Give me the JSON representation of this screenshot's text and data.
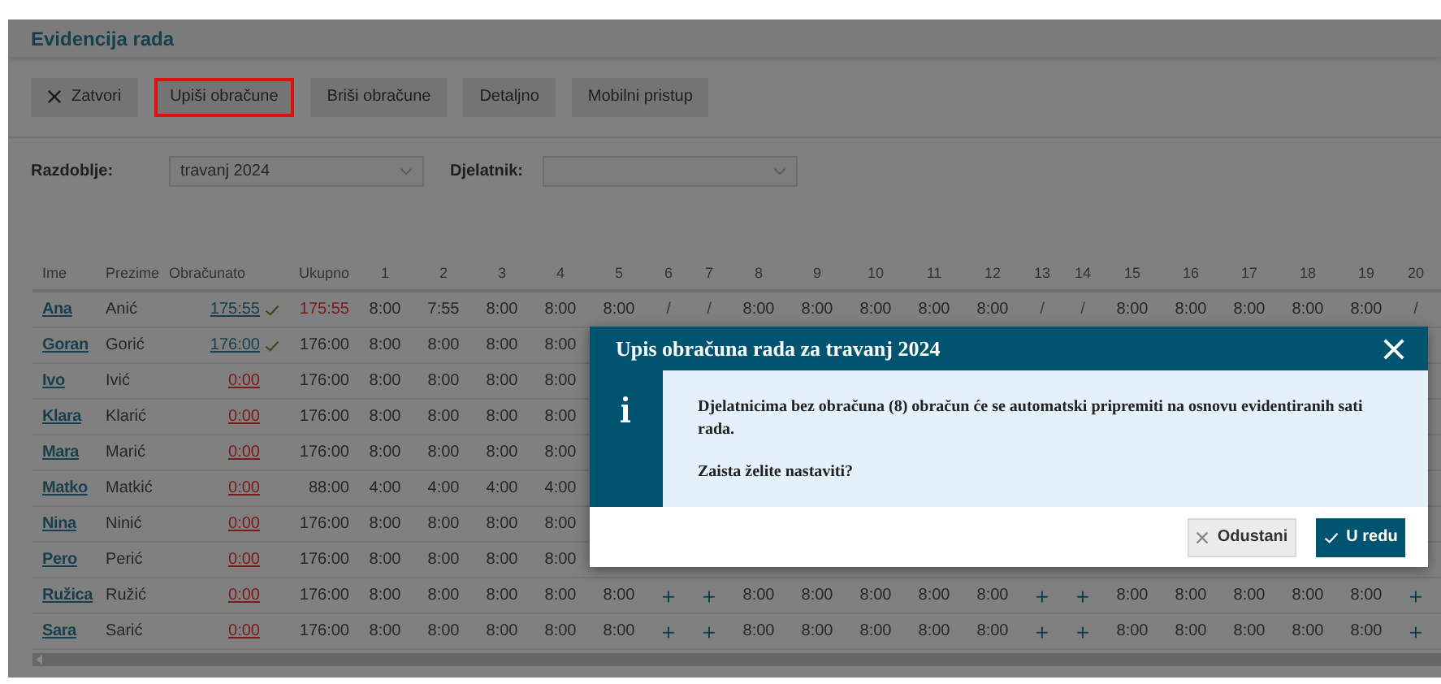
{
  "page": {
    "title": "Evidencija rada"
  },
  "toolbar": [
    {
      "label": "Zatvori",
      "kind": "close",
      "highlighted": false
    },
    {
      "label": "Upiši obračune",
      "kind": "plain",
      "highlighted": true
    },
    {
      "label": "Briši obračune",
      "kind": "plain",
      "highlighted": false
    },
    {
      "label": "Detaljno",
      "kind": "plain",
      "highlighted": false
    },
    {
      "label": "Mobilni pristup",
      "kind": "plain",
      "highlighted": false
    }
  ],
  "filters": [
    {
      "label": "Razdoblje:",
      "value": "travanj 2024"
    },
    {
      "label": "Djelatnik:"
    }
  ],
  "table": {
    "columns": [
      "Ime",
      "Prezime",
      "Obračunato",
      "Ukupno"
    ],
    "day_columns": [
      {
        "label": "1",
        "weekend": false
      },
      {
        "label": "2",
        "weekend": false
      },
      {
        "label": "3",
        "weekend": false
      },
      {
        "label": "4",
        "weekend": false
      },
      {
        "label": "5",
        "weekend": false
      },
      {
        "label": "6",
        "weekend": true
      },
      {
        "label": "7",
        "weekend": true
      },
      {
        "label": "8",
        "weekend": false
      },
      {
        "label": "9",
        "weekend": false
      },
      {
        "label": "10",
        "weekend": false
      },
      {
        "label": "11",
        "weekend": false
      },
      {
        "label": "12",
        "weekend": false
      },
      {
        "label": "13",
        "weekend": true
      },
      {
        "label": "14",
        "weekend": true
      },
      {
        "label": "15",
        "weekend": false
      },
      {
        "label": "16",
        "weekend": false
      },
      {
        "label": "17",
        "weekend": false
      },
      {
        "label": "18",
        "weekend": false
      },
      {
        "label": "19",
        "weekend": false
      },
      {
        "label": "20",
        "weekend": true
      }
    ],
    "rows": [
      {
        "ime": "Ana",
        "prezime": "Anić",
        "obracunato": "175:55",
        "obracunato_done": true,
        "ukupno": "175:55",
        "ukupno_warning": true,
        "days": [
          "8:00",
          "7:55",
          "8:00",
          "8:00",
          "8:00",
          {
            "text": "/",
            "kind": "off"
          },
          {
            "text": "/",
            "kind": "off"
          },
          "8:00",
          "8:00",
          "8:00",
          "8:00",
          "8:00",
          {
            "text": "/",
            "kind": "off"
          },
          {
            "text": "/",
            "kind": "off"
          },
          "8:00",
          "8:00",
          "8:00",
          "8:00",
          "8:00",
          {
            "text": "/",
            "kind": "off"
          }
        ]
      },
      {
        "ime": "Goran",
        "prezime": "Gorić",
        "obracunato": "176:00",
        "obracunato_done": true,
        "ukupno": "176:00",
        "ukupno_warning": false,
        "days": [
          "8:00",
          "8:00",
          "8:00",
          "8:00"
        ]
      },
      {
        "ime": "Ivo",
        "prezime": "Ivić",
        "obracunato": "0:00",
        "obracunato_done": false,
        "ukupno": "176:00",
        "ukupno_warning": false,
        "days": [
          "8:00",
          "8:00",
          "8:00",
          "8:00"
        ]
      },
      {
        "ime": "Klara",
        "prezime": "Klarić",
        "obracunato": "0:00",
        "obracunato_done": false,
        "ukupno": "176:00",
        "ukupno_warning": false,
        "days": [
          "8:00",
          "8:00",
          "8:00",
          "8:00"
        ]
      },
      {
        "ime": "Mara",
        "prezime": "Marić",
        "obracunato": "0:00",
        "obracunato_done": false,
        "ukupno": "176:00",
        "ukupno_warning": false,
        "days": [
          "8:00",
          "8:00",
          "8:00",
          "8:00"
        ]
      },
      {
        "ime": "Matko",
        "prezime": "Matkić",
        "obracunato": "0:00",
        "obracunato_done": false,
        "ukupno": "88:00",
        "ukupno_warning": false,
        "days": [
          "4:00",
          "4:00",
          "4:00",
          "4:00"
        ]
      },
      {
        "ime": "Nina",
        "prezime": "Ninić",
        "obracunato": "0:00",
        "obracunato_done": false,
        "ukupno": "176:00",
        "ukupno_warning": false,
        "days": [
          "8:00",
          "8:00",
          "8:00",
          "8:00"
        ]
      },
      {
        "ime": "Pero",
        "prezime": "Perić",
        "obracunato": "0:00",
        "obracunato_done": false,
        "ukupno": "176:00",
        "ukupno_warning": false,
        "days": [
          "8:00",
          "8:00",
          "8:00",
          "8:00"
        ]
      },
      {
        "ime": "Ružica",
        "prezime": "Ružić",
        "obracunato": "0:00",
        "obracunato_done": false,
        "ukupno": "176:00",
        "ukupno_warning": false,
        "days": [
          "8:00",
          "8:00",
          "8:00",
          "8:00",
          "8:00",
          {
            "text": "+",
            "kind": "add"
          },
          {
            "text": "+",
            "kind": "add"
          },
          "8:00",
          "8:00",
          "8:00",
          "8:00",
          "8:00",
          {
            "text": "+",
            "kind": "add"
          },
          {
            "text": "+",
            "kind": "add"
          },
          "8:00",
          "8:00",
          "8:00",
          "8:00",
          "8:00",
          {
            "text": "+",
            "kind": "add"
          }
        ]
      },
      {
        "ime": "Sara",
        "prezime": "Sarić",
        "obracunato": "0:00",
        "obracunato_done": false,
        "ukupno": "176:00",
        "ukupno_warning": false,
        "days": [
          "8:00",
          "8:00",
          "8:00",
          "8:00",
          "8:00",
          {
            "text": "+",
            "kind": "add"
          },
          {
            "text": "+",
            "kind": "add"
          },
          "8:00",
          "8:00",
          "8:00",
          "8:00",
          "8:00",
          {
            "text": "+",
            "kind": "add"
          },
          {
            "text": "+",
            "kind": "add"
          },
          "8:00",
          "8:00",
          "8:00",
          "8:00",
          "8:00",
          {
            "text": "+",
            "kind": "add"
          }
        ]
      }
    ]
  },
  "modal": {
    "title": "Upis obračuna rada za travanj 2024",
    "message": "Djelatnicima bez obračuna (8) obračun će se automatski pripremiti na osnovu evidentiranih sati rada.",
    "question": "Zaista želite nastaviti?",
    "buttons": [
      {
        "label": "Odustani",
        "kind": "cancel"
      },
      {
        "label": "U redu",
        "kind": "ok"
      }
    ]
  }
}
